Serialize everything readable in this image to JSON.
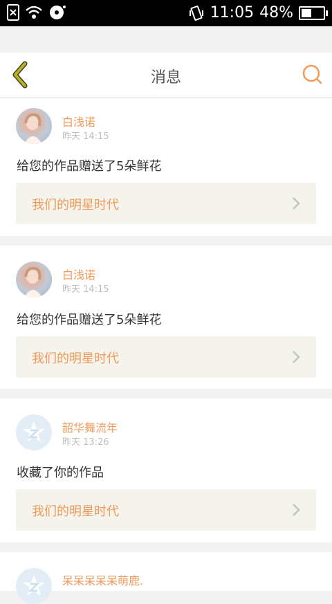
{
  "status_bar": {
    "time": "11:05",
    "battery_percent": "48%"
  },
  "nav": {
    "title": "消息"
  },
  "messages": [
    {
      "user": "白浅诺",
      "time": "昨天 14:15",
      "action": "给您的作品赠送了5朵鲜花",
      "work": "我们的明星时代",
      "avatar": "photo"
    },
    {
      "user": "白浅诺",
      "time": "昨天 14:15",
      "action": "给您的作品赠送了5朵鲜花",
      "work": "我们的明星时代",
      "avatar": "photo"
    },
    {
      "user": "韶华舞流年",
      "time": "昨天 13:26",
      "action": "收藏了你的作品",
      "work": "我们的明星时代",
      "avatar": "default"
    },
    {
      "user": "呆呆呆呆呆萌鹿.",
      "avatar": "default"
    }
  ],
  "colors": {
    "accent": "#f09a5a",
    "back_arrow": "#b9b223",
    "work_bg": "#f4f3ec"
  }
}
